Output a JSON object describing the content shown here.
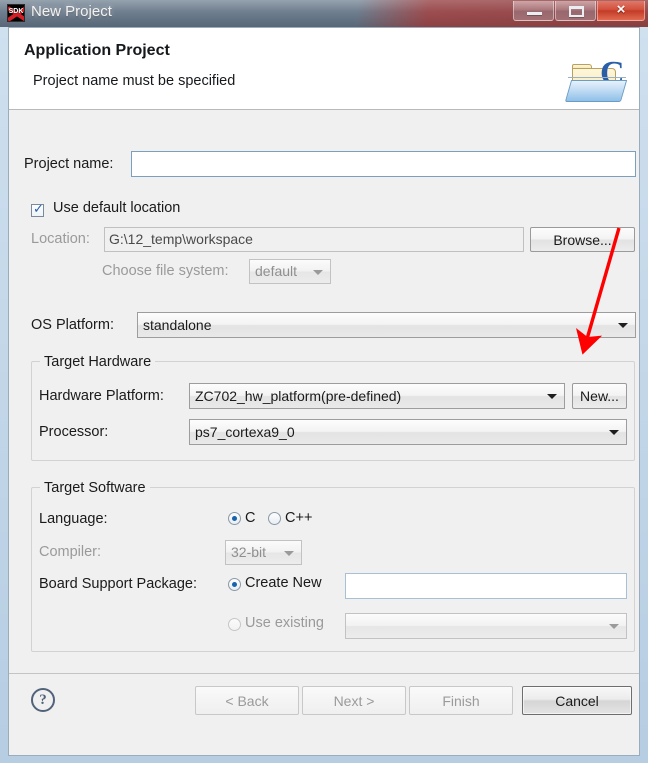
{
  "window": {
    "title": "New Project",
    "app_icon": "sdk-icon",
    "controls": {
      "minimize": "minimize-button",
      "maximize": "maximize-button",
      "close": "×"
    }
  },
  "header": {
    "title": "Application Project",
    "subtitle": "Project name must be specified",
    "icon": "c-project-folder-icon"
  },
  "form": {
    "project_name": {
      "label": "Project name:",
      "value": "",
      "placeholder": ""
    },
    "use_default_location": {
      "label": "Use default location",
      "checked": true
    },
    "location": {
      "label": "Location:",
      "value": "G:\\12_temp\\workspace",
      "disabled": true
    },
    "browse_button": "Browse...",
    "choose_file_system": {
      "label": "Choose file system:",
      "value": "default",
      "disabled": true
    },
    "os_platform": {
      "label": "OS Platform:",
      "value": "standalone"
    }
  },
  "target_hardware": {
    "legend": "Target Hardware",
    "hardware_platform": {
      "label": "Hardware Platform:",
      "value": "ZC702_hw_platform(pre-defined)"
    },
    "new_button": "New...",
    "processor": {
      "label": "Processor:",
      "value": "ps7_cortexa9_0"
    }
  },
  "target_software": {
    "legend": "Target Software",
    "language": {
      "label": "Language:",
      "options": [
        {
          "label": "C",
          "selected": true,
          "disabled": false
        },
        {
          "label": "C++",
          "selected": false,
          "disabled": false
        }
      ]
    },
    "compiler": {
      "label": "Compiler:",
      "value": "32-bit",
      "disabled": true
    },
    "bsp": {
      "label": "Board Support Package:",
      "create_new": {
        "label": "Create New",
        "selected": true,
        "value": ""
      },
      "use_existing": {
        "label": "Use existing",
        "selected": false,
        "disabled": true,
        "value": ""
      }
    }
  },
  "buttonbar": {
    "help": "?",
    "back": "< Back",
    "next": "Next >",
    "finish": "Finish",
    "cancel": "Cancel"
  },
  "colors": {
    "accent": "#1763ad",
    "annotation": "#ff0000",
    "dialog_bg": "#f0f0f0",
    "frame": "#c2d6e8"
  }
}
